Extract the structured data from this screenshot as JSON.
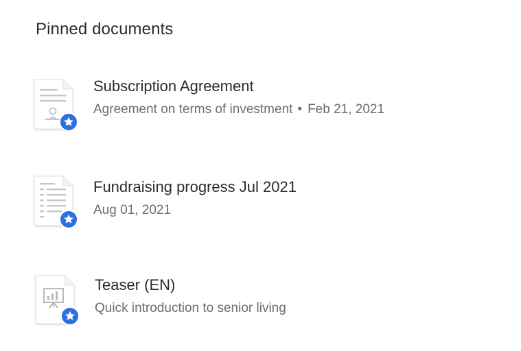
{
  "section": {
    "title": "Pinned documents"
  },
  "documents": [
    {
      "title": "Subscription Agreement",
      "description": "Agreement on terms of investment",
      "date": "Feb 21, 2021",
      "icon": "signed-contract-icon",
      "badge": "star-badge-icon"
    },
    {
      "title": "Fundraising progress Jul 2021",
      "date": "Aug 01, 2021",
      "icon": "spreadsheet-report-icon",
      "badge": "star-badge-icon"
    },
    {
      "title": "Teaser (EN)",
      "description": "Quick introduction to senior living",
      "icon": "presentation-icon",
      "badge": "star-badge-icon"
    }
  ],
  "colors": {
    "badge": "#2f6fe4",
    "title_text": "#2b2b2f",
    "meta_text": "#6c6c72",
    "icon_lines": "#c7c7cb"
  }
}
